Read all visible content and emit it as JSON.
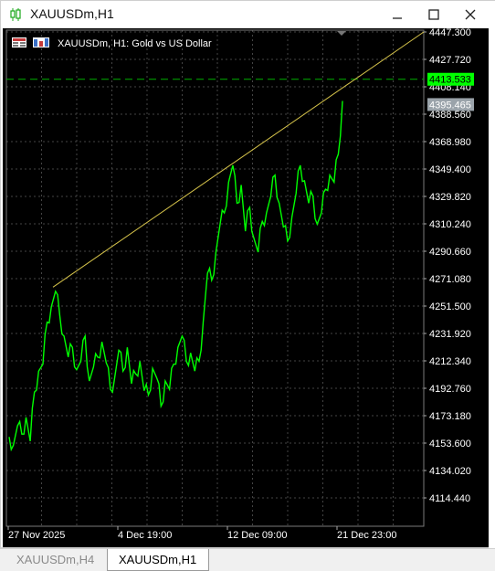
{
  "window": {
    "title": "XAUUSDm,H1",
    "icon": "candlestick-icon",
    "minimize_label": "—",
    "maximize_label": "☐",
    "close_label": "✕"
  },
  "chart": {
    "header_text": "XAUUSDm, H1:  Gold vs US Dollar",
    "colors": {
      "background": "#000000",
      "grid": "#444444",
      "price_line": "#00ff00",
      "trendline": "#d4c24a",
      "alert_line": "#00b000",
      "alert_label_bg": "#00ff00",
      "current_label_bg": "#9aa3aa"
    },
    "price_labels": [
      "4447.300",
      "4427.720",
      "4408.140",
      "4388.560",
      "4368.980",
      "4349.400",
      "4329.820",
      "4310.240",
      "4290.660",
      "4271.080",
      "4251.500",
      "4231.920",
      "4212.340",
      "4192.760",
      "4173.180",
      "4153.600",
      "4134.020",
      "4114.440"
    ],
    "alert_price": "4413.533",
    "current_price": "4395.465",
    "time_labels": [
      "27 Nov 2025",
      "4 Dec 19:00",
      "12 Dec 09:00",
      "21 Dec 23:00"
    ]
  },
  "chart_data": {
    "type": "line",
    "title": "XAUUSDm, H1:  Gold vs US Dollar",
    "xlabel": "",
    "ylabel": "",
    "ylim": [
      4100,
      4450
    ],
    "grid": true,
    "x": [
      "27 Nov 2025",
      "4 Dec 19:00",
      "12 Dec 09:00",
      "21 Dec 23:00"
    ],
    "series": [
      {
        "name": "",
        "values": [
          4158,
          4152,
          4166,
          4160,
          4172,
          4155,
          4190,
          4205,
          4210,
          4240,
          4251,
          4262,
          4245,
          4230,
          4215,
          4222,
          4206,
          4212,
          4230,
          4198,
          4208,
          4215,
          4226,
          4211,
          4192,
          4200,
          4220,
          4205,
          4222,
          4196,
          4203,
          4212,
          4191,
          4188,
          4207,
          4200,
          4180,
          4198,
          4192,
          4210,
          4222,
          4230,
          4212,
          4218,
          4205,
          4212,
          4240,
          4275,
          4270,
          4290,
          4310,
          4318,
          4340,
          4352,
          4325,
          4338,
          4305,
          4322,
          4300,
          4290,
          4312,
          4318,
          4330,
          4345,
          4325,
          4308,
          4298,
          4315,
          4332,
          4352,
          4341,
          4325,
          4330,
          4310,
          4318,
          4335,
          4345,
          4340,
          4360,
          4398
        ]
      }
    ],
    "trendline": {
      "from": [
        "27 Nov 2025",
        4265
      ],
      "to": [
        "21 Dec 23:00",
        4447.3
      ]
    },
    "hlines": [
      4413.533
    ]
  }
}
